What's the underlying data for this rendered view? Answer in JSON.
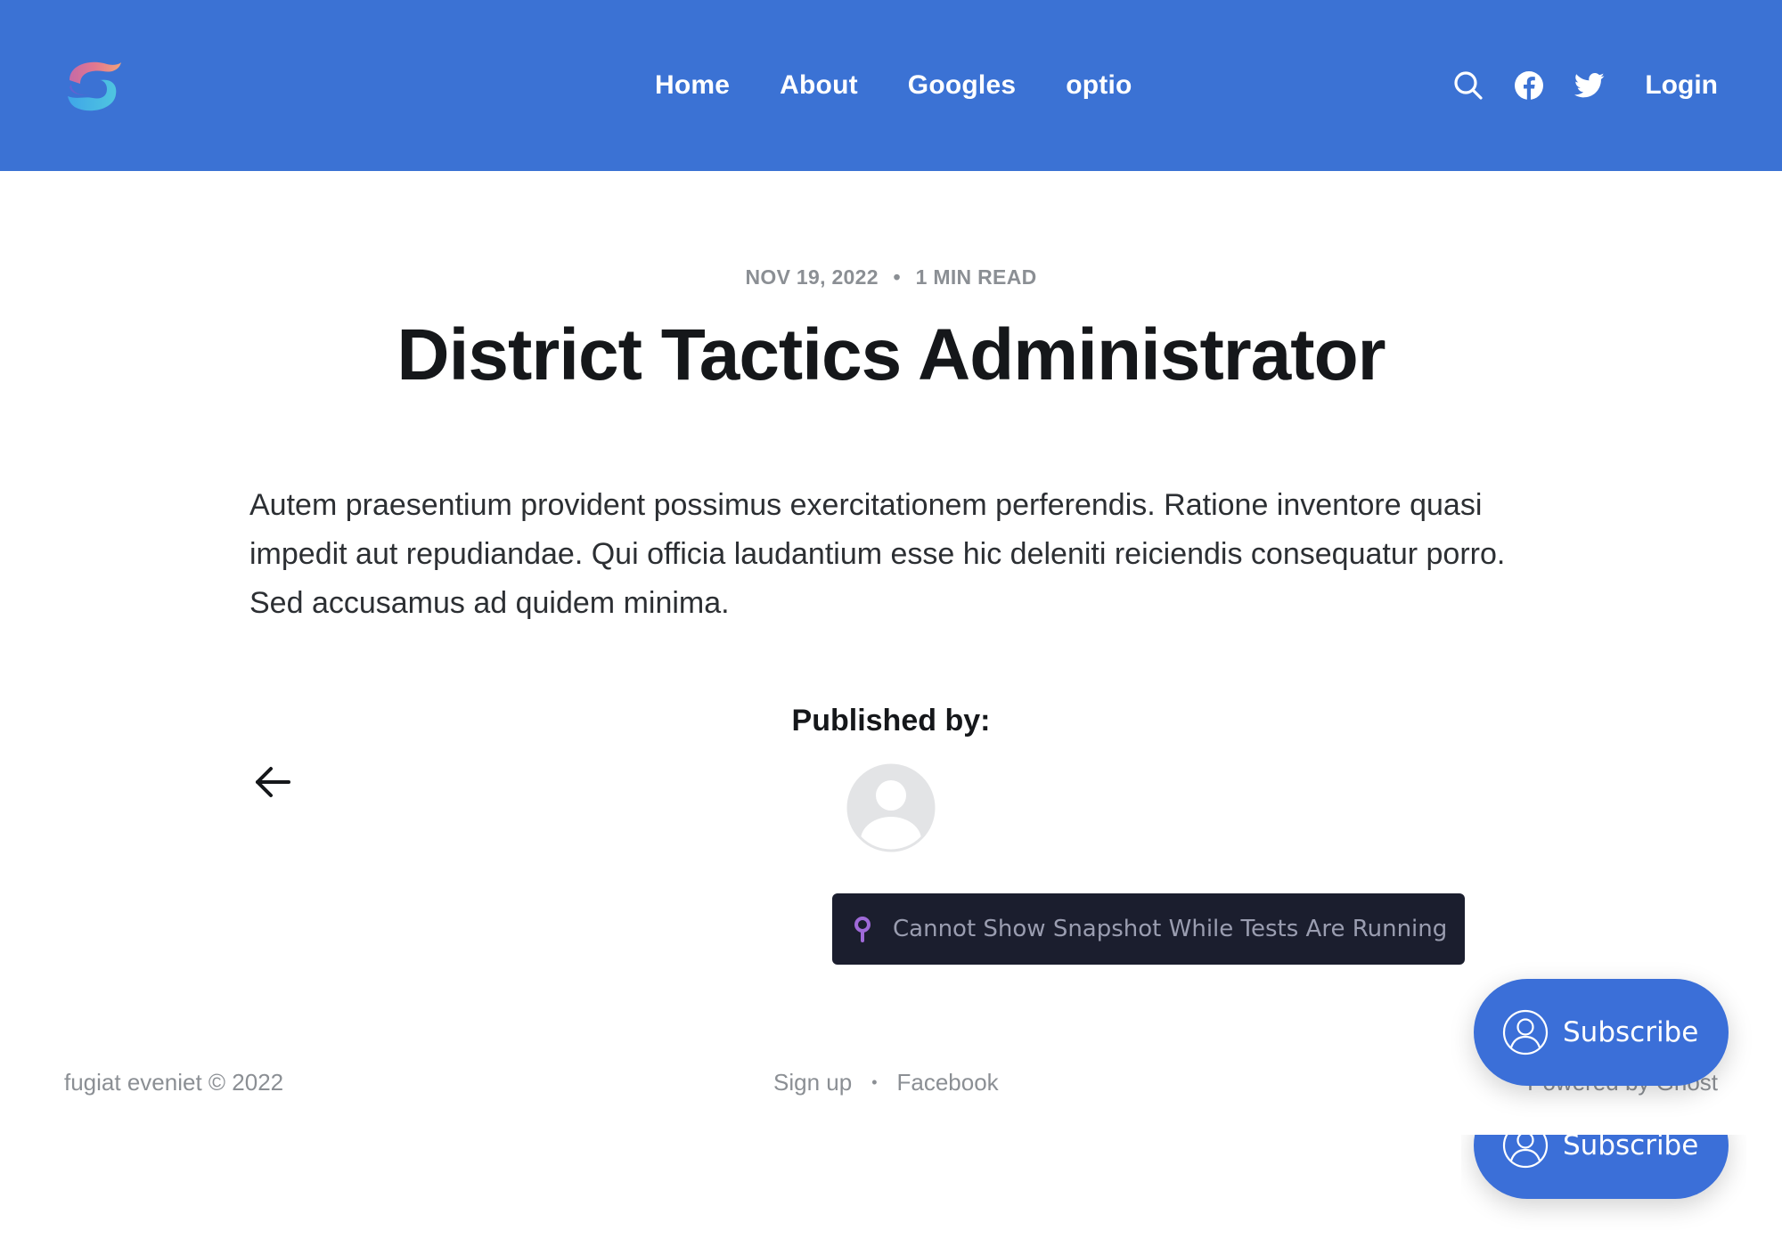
{
  "header": {
    "background": "#3b72d4",
    "logo_icon": "ghost-site-logo-icon",
    "nav": [
      {
        "label": "Home"
      },
      {
        "label": "About"
      },
      {
        "label": "Googles"
      },
      {
        "label": "optio"
      }
    ],
    "actions": {
      "search_icon": "search-icon",
      "facebook_icon": "facebook-icon",
      "twitter_icon": "twitter-icon",
      "login_label": "Login"
    }
  },
  "post": {
    "date": "NOV 19, 2022",
    "meta_separator": "•",
    "reading_time": "1 MIN READ",
    "title": "District Tactics Administrator",
    "body": "Autem praesentium provident possimus exercitationem perferendis. Ratione inventore quasi impedit aut repudiandae. Qui officia laudantium esse hic deleniti reiciendis consequatur porro. Sed accusamus ad quidem minima."
  },
  "author": {
    "heading": "Published by:",
    "avatar_icon": "avatar-placeholder-icon",
    "back_icon": "arrow-left-icon"
  },
  "test_banner": {
    "message": "Cannot Show Snapshot While Tests Are Running",
    "icon": "pin-icon",
    "background": "#1b1e2e",
    "icon_color": "#9f6ad8"
  },
  "footer": {
    "copyright": "fugiat eveniet © 2022",
    "links": [
      {
        "label": "Sign up"
      },
      {
        "label": "Facebook"
      }
    ],
    "separator": "•",
    "powered_by": "Powered by Ghost"
  },
  "subscribe": {
    "label": "Subscribe",
    "icon": "user-circle-icon",
    "background": "#3b6fd8"
  }
}
